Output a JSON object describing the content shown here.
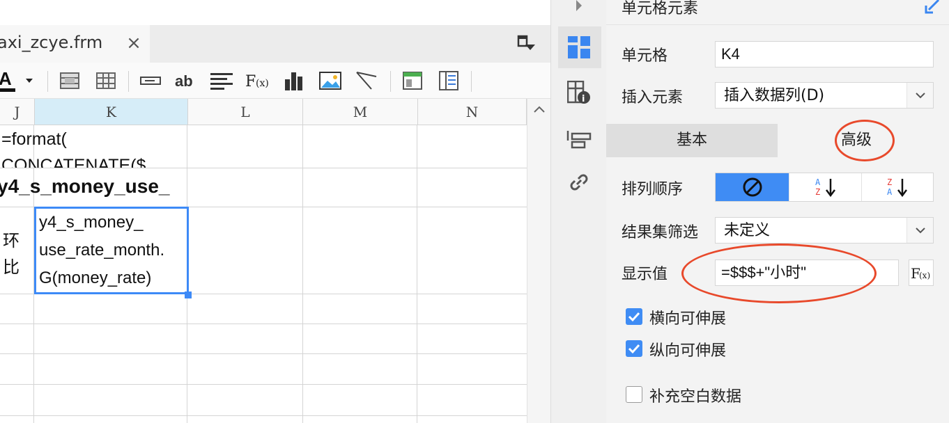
{
  "editor": {
    "file_tab": {
      "label": "axi_zcye.frm",
      "close": "×"
    },
    "toolbar_icons": [
      "font-color-icon",
      "dropdown-arrow-icon",
      "merge-cells-icon",
      "split-cells-icon",
      "text-field-icon",
      "ab-text-icon",
      "align-left-icon",
      "formula-icon",
      "bar-chart-icon",
      "image-icon",
      "slash-line-icon",
      "frame-icon",
      "table-icon"
    ],
    "columns": [
      "J",
      "K",
      "L",
      "M",
      "N"
    ],
    "cells": {
      "j2_line1": "=format(",
      "j2_line2": "CONCATENATE($",
      "j3": "y4_s_money_use_",
      "j4_line1": "环",
      "j4_line2": "比",
      "k4_line1": "y4_s_money_",
      "k4_line2": "use_rate_month.",
      "k4_line3": "G(money_rate)"
    },
    "accent": "#3d8af7"
  },
  "strip": {
    "icons": [
      "collapse-arrow-icon",
      "cell-element-icon",
      "cell-attribute-icon",
      "widget-icon",
      "link-icon"
    ]
  },
  "panel": {
    "title": "单元格元素",
    "cell_label": "单元格",
    "cell_value": "K4",
    "insert_label": "插入元素",
    "insert_value": "插入数据列(D)",
    "tab_basic": "基本",
    "tab_advanced": "高级",
    "sort_label": "排列顺序",
    "sort_options": [
      "no-sort-icon",
      "sort-ascending-icon",
      "sort-descending-icon"
    ],
    "filter_label": "结果集筛选",
    "filter_value": "未定义",
    "display_label": "显示值",
    "display_value": "=$$$+\"小时\"",
    "fx_label": "F(x)",
    "checkbox_h": {
      "label": "横向可伸展",
      "checked": true
    },
    "checkbox_v": {
      "label": "纵向可伸展",
      "checked": true
    },
    "checkbox_fill": {
      "label": "补充空白数据",
      "checked": false
    },
    "accent": "#3f8cf4",
    "annotation_color": "#e8492b"
  }
}
